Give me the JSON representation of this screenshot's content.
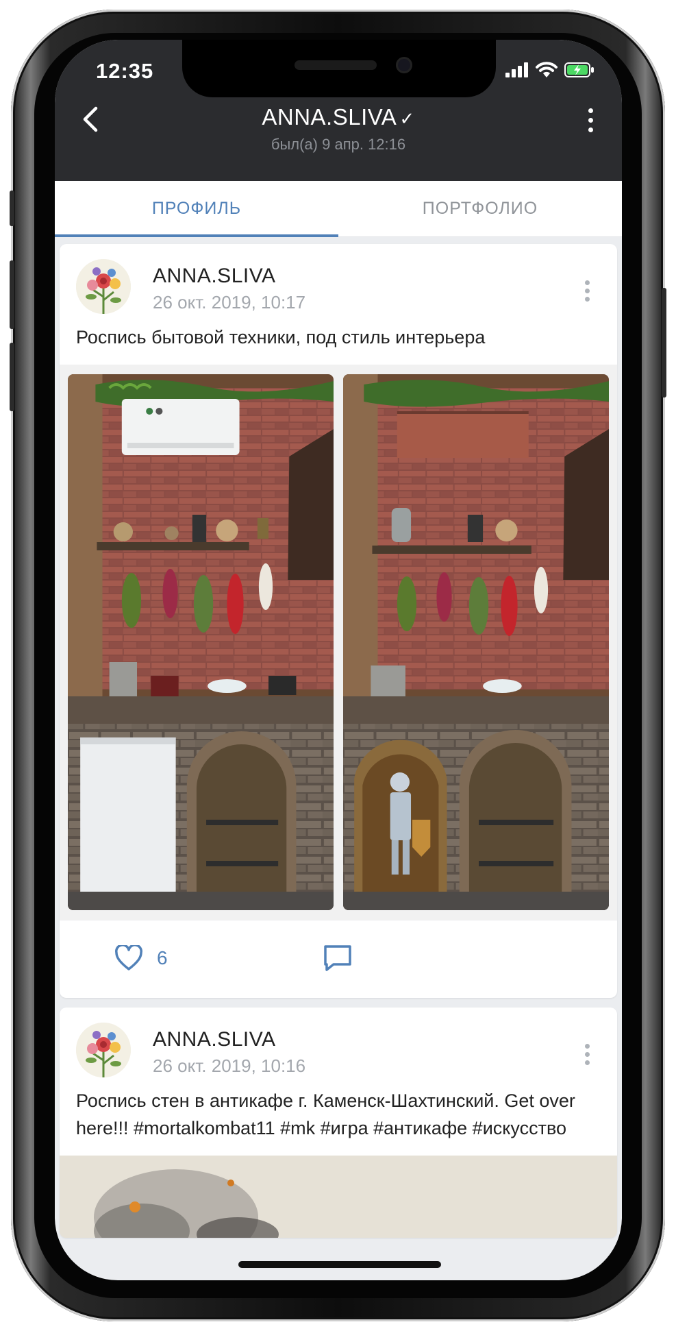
{
  "status_bar": {
    "time": "12:35"
  },
  "header": {
    "title": "ANNA.SLIVA",
    "verified_mark": "✓",
    "last_seen": "был(а) 9 апр. 12:16"
  },
  "tabs": [
    {
      "label": "ПРОФИЛЬ",
      "active": true
    },
    {
      "label": "ПОРТФОЛИО",
      "active": false
    }
  ],
  "posts": [
    {
      "author": "ANNA.SLIVA",
      "date": "26 окт. 2019, 10:17",
      "text": "Роспись бытовой техники, под стиль интерьера",
      "likes": "6"
    },
    {
      "author": "ANNA.SLIVA",
      "date": "26 окт. 2019, 10:16",
      "text": "Роспись стен в антикафе г. Каменск-Шахтинский. Get over here!!! #mortalkombat11 #mk #игра #антикафе #искусство"
    }
  ],
  "colors": {
    "accent": "#5181b8",
    "header_bg": "#2b2c2f",
    "feed_bg": "#ebedf0"
  },
  "icons": [
    "back-arrow-icon",
    "more-vertical-icon",
    "heart-icon",
    "comment-icon",
    "signal-icon",
    "wifi-icon",
    "battery-icon"
  ]
}
